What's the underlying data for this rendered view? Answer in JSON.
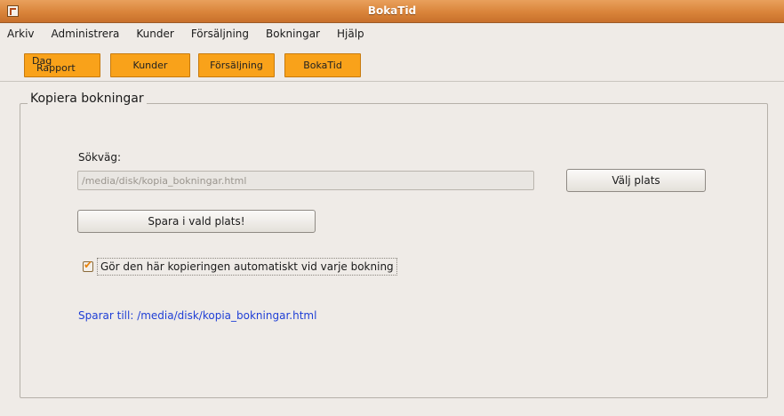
{
  "window": {
    "title": "BokaTid",
    "icon": "app-icon"
  },
  "menubar": {
    "items": [
      {
        "label": "Arkiv"
      },
      {
        "label": "Administrera"
      },
      {
        "label": "Kunder"
      },
      {
        "label": "Försäljning"
      },
      {
        "label": "Bokningar"
      },
      {
        "label": "Hjälp"
      }
    ]
  },
  "toolbar": {
    "dag_line1": "Dag",
    "dag_line2": "Rapport",
    "kunder": "Kunder",
    "forsaljning": "Försäljning",
    "bokatid": "BokaTid",
    "button_color": "#f9a21a"
  },
  "panel": {
    "title": "Kopiera bokningar",
    "path_label": "Sökväg:",
    "path_value": "/media/disk/kopia_bokningar.html",
    "choose_button": "Välj plats",
    "save_button": "Spara i vald plats!",
    "auto_copy": {
      "label": "Gör den här kopieringen automatiskt vid varje bokning",
      "checked": true
    },
    "status_text": "Sparar till: /media/disk/kopia_bokningar.html",
    "status_color": "#1f3fd6"
  }
}
